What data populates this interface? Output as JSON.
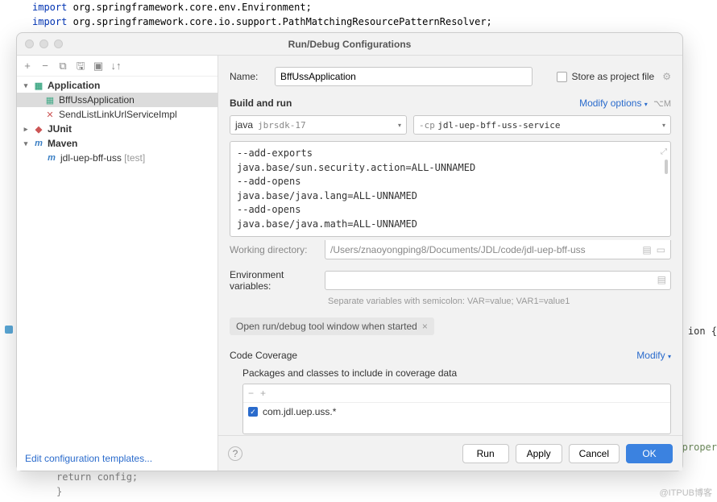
{
  "bg": {
    "line1_kw": "import",
    "line1_pkg": "org.springframework.core.env.Environment;",
    "line2_kw": "import",
    "line2_pkg": "org.springframework.core.io.support.PathMatchingResourcePatternResolver;",
    "bottom1": "return config;",
    "bottom2": "}",
    "right_frag": "ion  {",
    "right_frag2": "proper"
  },
  "dialog": {
    "title": "Run/Debug Configurations",
    "tree": {
      "application": "Application",
      "bffuss": "BffUssApplication",
      "send": "SendListLinkUrlServiceImpl",
      "junit": "JUnit",
      "maven": "Maven",
      "maven_item": "jdl-uep-bff-uss",
      "maven_suffix": " [test]"
    },
    "edit_templates": "Edit configuration templates...",
    "name_label": "Name:",
    "name_value": "BffUssApplication",
    "store_label": "Store as project file",
    "build_run": "Build and run",
    "modify_options": "Modify options",
    "modify_shortcut": "⌥M",
    "java_label": "java",
    "sdk": "jbrsdk-17",
    "cp_flag": "-cp",
    "cp_module": "jdl-uep-bff-uss-service",
    "vm_options": "--add-exports\njava.base/sun.security.action=ALL-UNNAMED\n--add-opens\njava.base/java.lang=ALL-UNNAMED\n--add-opens\njava.base/java.math=ALL-UNNAMED",
    "working_dir_label": "Working directory:",
    "working_dir": "/Users/znaoyongping8/Documents/JDL/code/jdl-uep-bff-uss",
    "env_label": "Environment variables:",
    "env_hint": "Separate variables with semicolon: VAR=value; VAR1=value1",
    "chip_label": "Open run/debug tool window when started",
    "code_coverage": "Code Coverage",
    "modify": "Modify",
    "cov_sub": "Packages and classes to include in coverage data",
    "cov_item": "com.jdl.uep.uss.*",
    "buttons": {
      "run": "Run",
      "apply": "Apply",
      "cancel": "Cancel",
      "ok": "OK"
    }
  },
  "watermark": "@ITPUB博客"
}
